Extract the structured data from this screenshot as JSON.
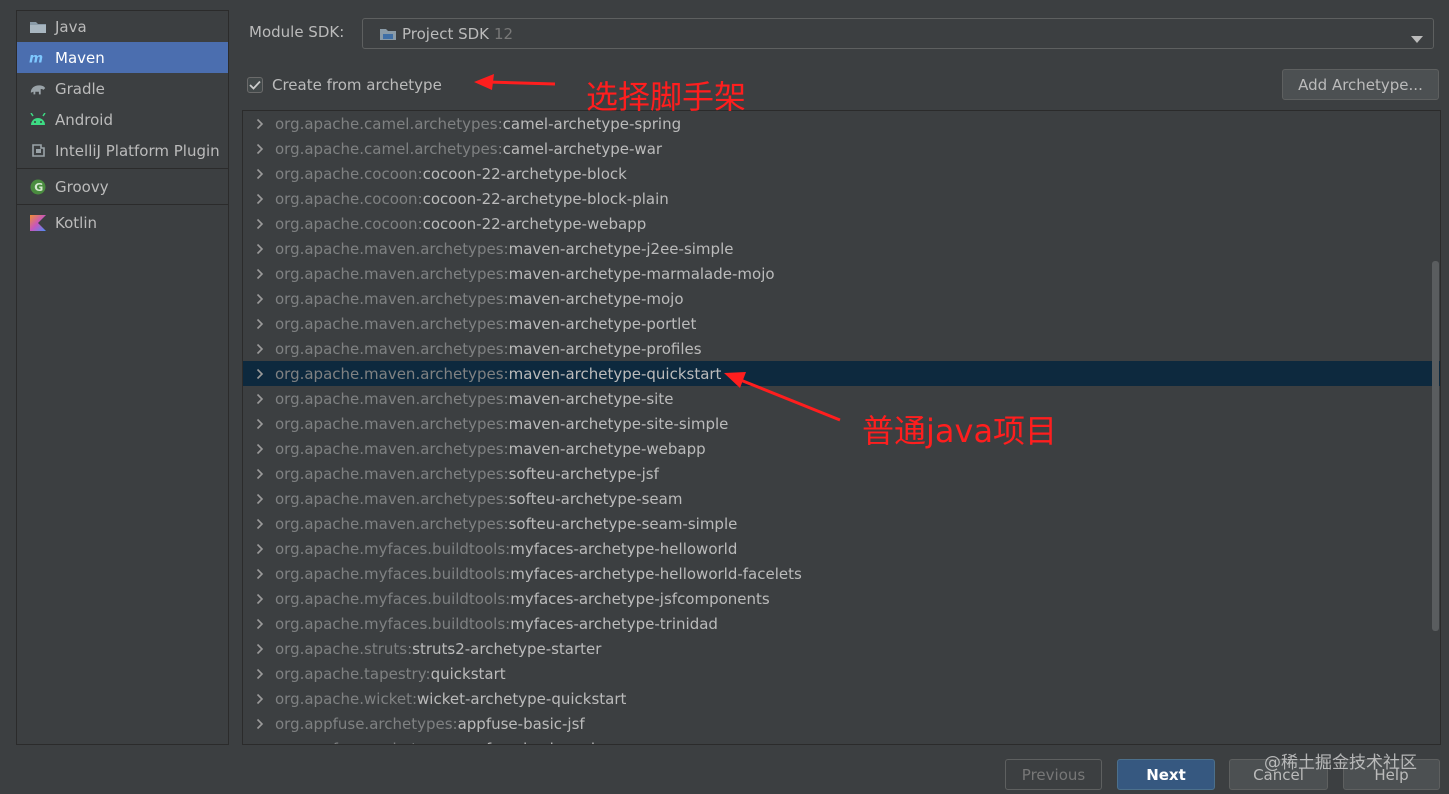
{
  "sidebar": {
    "items": [
      {
        "label": "Java",
        "icon": "folder-icon"
      },
      {
        "label": "Maven",
        "icon": "maven-icon",
        "selected": true
      },
      {
        "label": "Gradle",
        "icon": "gradle-elephant-icon"
      },
      {
        "label": "Android",
        "icon": "android-icon"
      },
      {
        "label": "IntelliJ Platform Plugin",
        "icon": "plugin-icon"
      },
      {
        "label": "Groovy",
        "icon": "groovy-icon"
      },
      {
        "label": "Kotlin",
        "icon": "kotlin-icon"
      }
    ]
  },
  "header": {
    "sdk_label": "Module SDK:",
    "sdk_value": "Project SDK",
    "sdk_version": "12",
    "archetype_checkbox_label": "Create from archetype",
    "archetype_checked": true,
    "add_archetype_label": "Add Archetype..."
  },
  "archetypes": [
    {
      "group": "org.apache.camel.archetypes:",
      "artifact": "camel-archetype-spring"
    },
    {
      "group": "org.apache.camel.archetypes:",
      "artifact": "camel-archetype-war"
    },
    {
      "group": "org.apache.cocoon:",
      "artifact": "cocoon-22-archetype-block"
    },
    {
      "group": "org.apache.cocoon:",
      "artifact": "cocoon-22-archetype-block-plain"
    },
    {
      "group": "org.apache.cocoon:",
      "artifact": "cocoon-22-archetype-webapp"
    },
    {
      "group": "org.apache.maven.archetypes:",
      "artifact": "maven-archetype-j2ee-simple"
    },
    {
      "group": "org.apache.maven.archetypes:",
      "artifact": "maven-archetype-marmalade-mojo"
    },
    {
      "group": "org.apache.maven.archetypes:",
      "artifact": "maven-archetype-mojo"
    },
    {
      "group": "org.apache.maven.archetypes:",
      "artifact": "maven-archetype-portlet"
    },
    {
      "group": "org.apache.maven.archetypes:",
      "artifact": "maven-archetype-profiles"
    },
    {
      "group": "org.apache.maven.archetypes:",
      "artifact": "maven-archetype-quickstart",
      "selected": true
    },
    {
      "group": "org.apache.maven.archetypes:",
      "artifact": "maven-archetype-site"
    },
    {
      "group": "org.apache.maven.archetypes:",
      "artifact": "maven-archetype-site-simple"
    },
    {
      "group": "org.apache.maven.archetypes:",
      "artifact": "maven-archetype-webapp"
    },
    {
      "group": "org.apache.maven.archetypes:",
      "artifact": "softeu-archetype-jsf"
    },
    {
      "group": "org.apache.maven.archetypes:",
      "artifact": "softeu-archetype-seam"
    },
    {
      "group": "org.apache.maven.archetypes:",
      "artifact": "softeu-archetype-seam-simple"
    },
    {
      "group": "org.apache.myfaces.buildtools:",
      "artifact": "myfaces-archetype-helloworld"
    },
    {
      "group": "org.apache.myfaces.buildtools:",
      "artifact": "myfaces-archetype-helloworld-facelets"
    },
    {
      "group": "org.apache.myfaces.buildtools:",
      "artifact": "myfaces-archetype-jsfcomponents"
    },
    {
      "group": "org.apache.myfaces.buildtools:",
      "artifact": "myfaces-archetype-trinidad"
    },
    {
      "group": "org.apache.struts:",
      "artifact": "struts2-archetype-starter"
    },
    {
      "group": "org.apache.tapestry:",
      "artifact": "quickstart"
    },
    {
      "group": "org.apache.wicket:",
      "artifact": "wicket-archetype-quickstart"
    },
    {
      "group": "org.appfuse.archetypes:",
      "artifact": "appfuse-basic-jsf"
    },
    {
      "group": "org.appfuse.archetypes:",
      "artifact": "appfuse-basic-spring"
    }
  ],
  "footer": {
    "previous_label": "Previous",
    "next_label": "Next",
    "cancel_label": "Cancel",
    "help_label": "Help"
  },
  "annotations": {
    "archetype_note": "选择脚手架",
    "quickstart_note": "普通java项目"
  },
  "watermark": "@稀土掘金技术社区",
  "colors": {
    "background": "#3c3f41",
    "selected_sidebar": "#4b6eaf",
    "selected_row": "#0d293e",
    "primary_button": "#365880",
    "annotation": "#ff1e1e"
  }
}
